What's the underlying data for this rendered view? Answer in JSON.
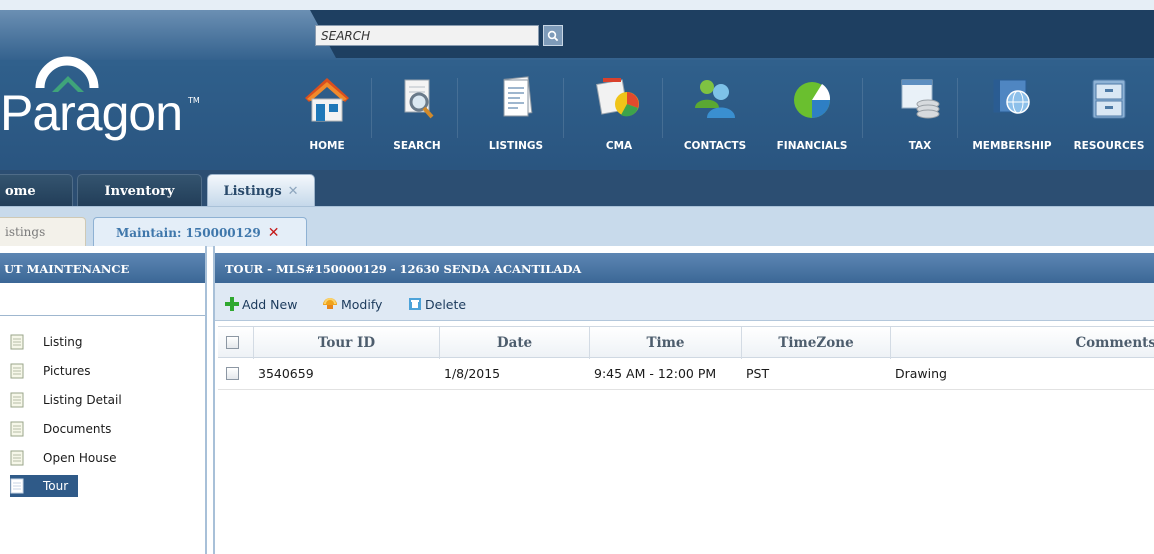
{
  "search": {
    "placeholder": "SEARCH"
  },
  "logo": {
    "text": "Paragon",
    "tm": "TM"
  },
  "nav": [
    {
      "label": "HOME",
      "icon": "house-icon"
    },
    {
      "label": "SEARCH",
      "icon": "magnifier-document-icon"
    },
    {
      "label": "LISTINGS",
      "icon": "listing-sheet-icon"
    },
    {
      "label": "CMA",
      "icon": "cma-chart-icon"
    },
    {
      "label": "CONTACTS",
      "icon": "people-icon"
    },
    {
      "label": "FINANCIALS",
      "icon": "pie-chart-icon"
    },
    {
      "label": "TAX",
      "icon": "tax-coins-icon"
    },
    {
      "label": "MEMBERSHIP",
      "icon": "membership-globe-icon"
    },
    {
      "label": "RESOURCES",
      "icon": "file-cabinet-icon"
    }
  ],
  "main_tabs": [
    {
      "label": "ome",
      "active": false
    },
    {
      "label": "Inventory",
      "active": false
    },
    {
      "label": "Listings",
      "active": true,
      "close": "✕"
    }
  ],
  "sub_tabs": [
    {
      "label": "istings",
      "active": false
    },
    {
      "label": "Maintain: 150000129",
      "active": true,
      "close": "✕"
    }
  ],
  "left_panel": {
    "title": "UT MAINTENANCE",
    "items": [
      {
        "label": "Listing",
        "selected": false
      },
      {
        "label": "Pictures",
        "selected": false
      },
      {
        "label": "Listing Detail",
        "selected": false
      },
      {
        "label": "Documents",
        "selected": false
      },
      {
        "label": "Open House",
        "selected": false
      },
      {
        "label": "Tour",
        "selected": true
      }
    ]
  },
  "right_panel": {
    "title": "TOUR - MLS#150000129 - 12630 SENDA ACANTILADA",
    "toolbar": {
      "add": "Add New",
      "modify": "Modify",
      "delete": "Delete"
    },
    "columns": [
      "Tour ID",
      "Date",
      "Time",
      "TimeZone",
      "Comments"
    ],
    "rows": [
      {
        "tour_id": "3540659",
        "date": "1/8/2015",
        "time": "9:45 AM - 12:00 PM",
        "timezone": "PST",
        "comments": "Drawing"
      }
    ]
  },
  "colors": {
    "header": "#2f5f8b",
    "accent": "#3b6796",
    "selected": "#2f5a88",
    "close_red": "#c41a1a"
  }
}
